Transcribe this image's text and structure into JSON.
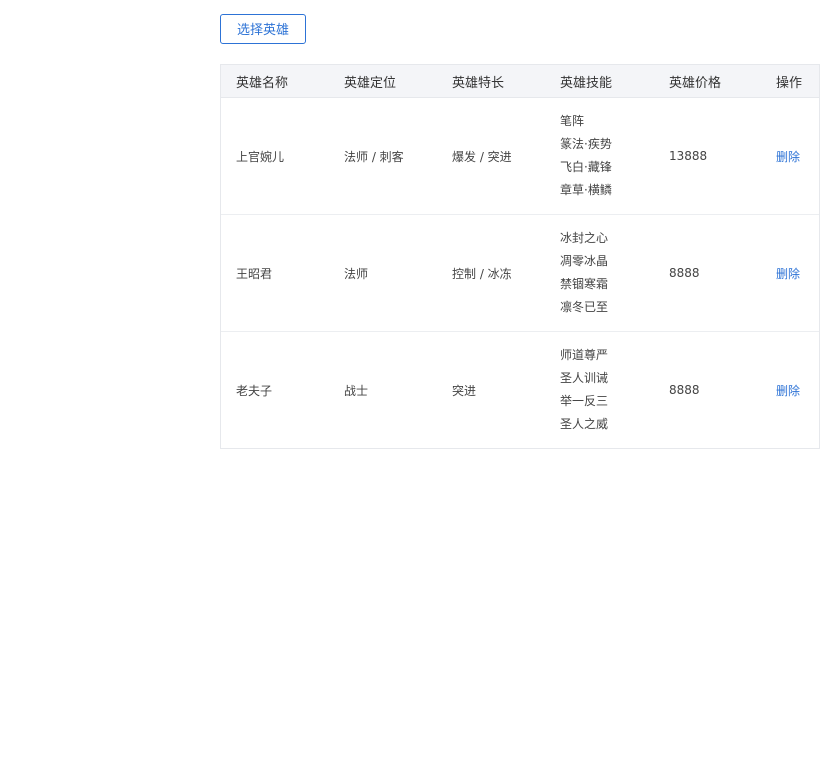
{
  "toolbar": {
    "select_label": "选择英雄"
  },
  "table": {
    "headers": [
      "英雄名称",
      "英雄定位",
      "英雄特长",
      "英雄技能",
      "英雄价格",
      "操作"
    ],
    "rows": [
      {
        "name": "上官婉儿",
        "role": "法师 / 刺客",
        "specialty": "爆发 / 突进",
        "skills": [
          "笔阵",
          "篆法·疾势",
          "飞白·藏锋",
          "章草·横鳞"
        ],
        "price": "13888",
        "action": "删除"
      },
      {
        "name": "王昭君",
        "role": "法师",
        "specialty": "控制 / 冰冻",
        "skills": [
          "冰封之心",
          "凋零冰晶",
          "禁锢寒霜",
          "凛冬已至"
        ],
        "price": "8888",
        "action": "删除"
      },
      {
        "name": "老夫子",
        "role": "战士",
        "specialty": "突进",
        "skills": [
          "师道尊严",
          "圣人训诫",
          "举一反三",
          "圣人之威"
        ],
        "price": "8888",
        "action": "删除"
      }
    ]
  },
  "colors": {
    "accent": "#2d73d6",
    "header_bg": "#f4f5f8",
    "border": "#e6e8ec"
  }
}
